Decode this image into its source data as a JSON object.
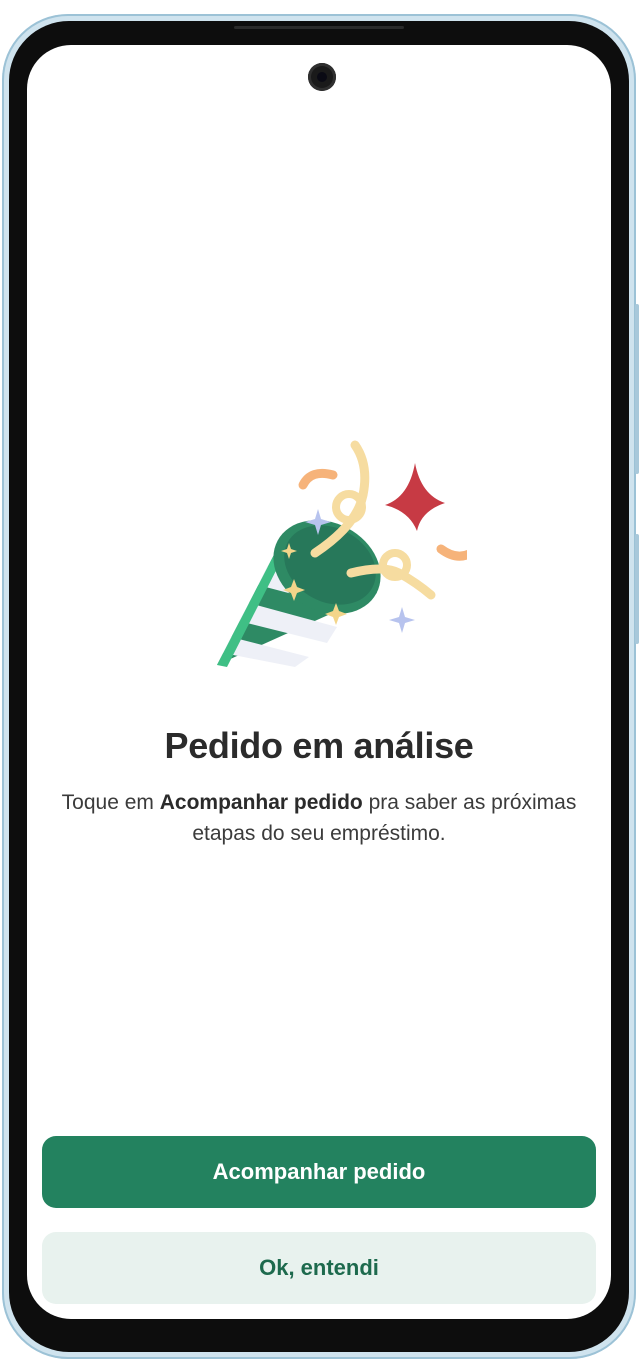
{
  "illustration": {
    "icon": "party-popper-icon"
  },
  "content": {
    "title": "Pedido em análise",
    "description_prefix": "Toque em ",
    "description_bold": "Acompanhar pedido",
    "description_suffix": " pra saber as próximas etapas do seu empréstimo."
  },
  "actions": {
    "primary_label": "Acompanhar pedido",
    "secondary_label": "Ok, entendi"
  },
  "colors": {
    "primary": "#23825f",
    "secondary_bg": "#e8f2ee",
    "secondary_text": "#1d6a4d",
    "title": "#2b2b2b"
  }
}
